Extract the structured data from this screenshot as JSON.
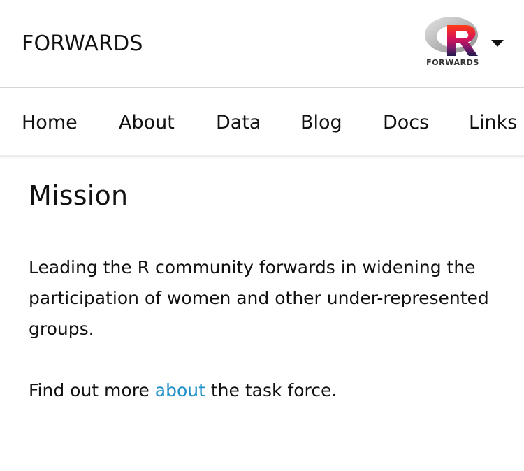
{
  "header": {
    "site_title": "FORWARDS",
    "logo": {
      "icon": "r-forwards-logo-icon",
      "letter": "R",
      "wordmark": "FORWARDS"
    },
    "menu_toggle_icon": "caret-down-icon"
  },
  "nav": {
    "items": [
      {
        "label": "Home"
      },
      {
        "label": "About"
      },
      {
        "label": "Data"
      },
      {
        "label": "Blog"
      },
      {
        "label": "Docs"
      },
      {
        "label": "Links"
      }
    ]
  },
  "main": {
    "title": "Mission",
    "mission_text": "Leading the R community forwards in widening the participation of women and other under-represented groups.",
    "more": {
      "prefix": "Find out more ",
      "link_text": "about",
      "suffix": " the task force."
    }
  },
  "colors": {
    "link": "#1e8fc8",
    "text": "#111111",
    "divider": "#d6d6d6"
  }
}
